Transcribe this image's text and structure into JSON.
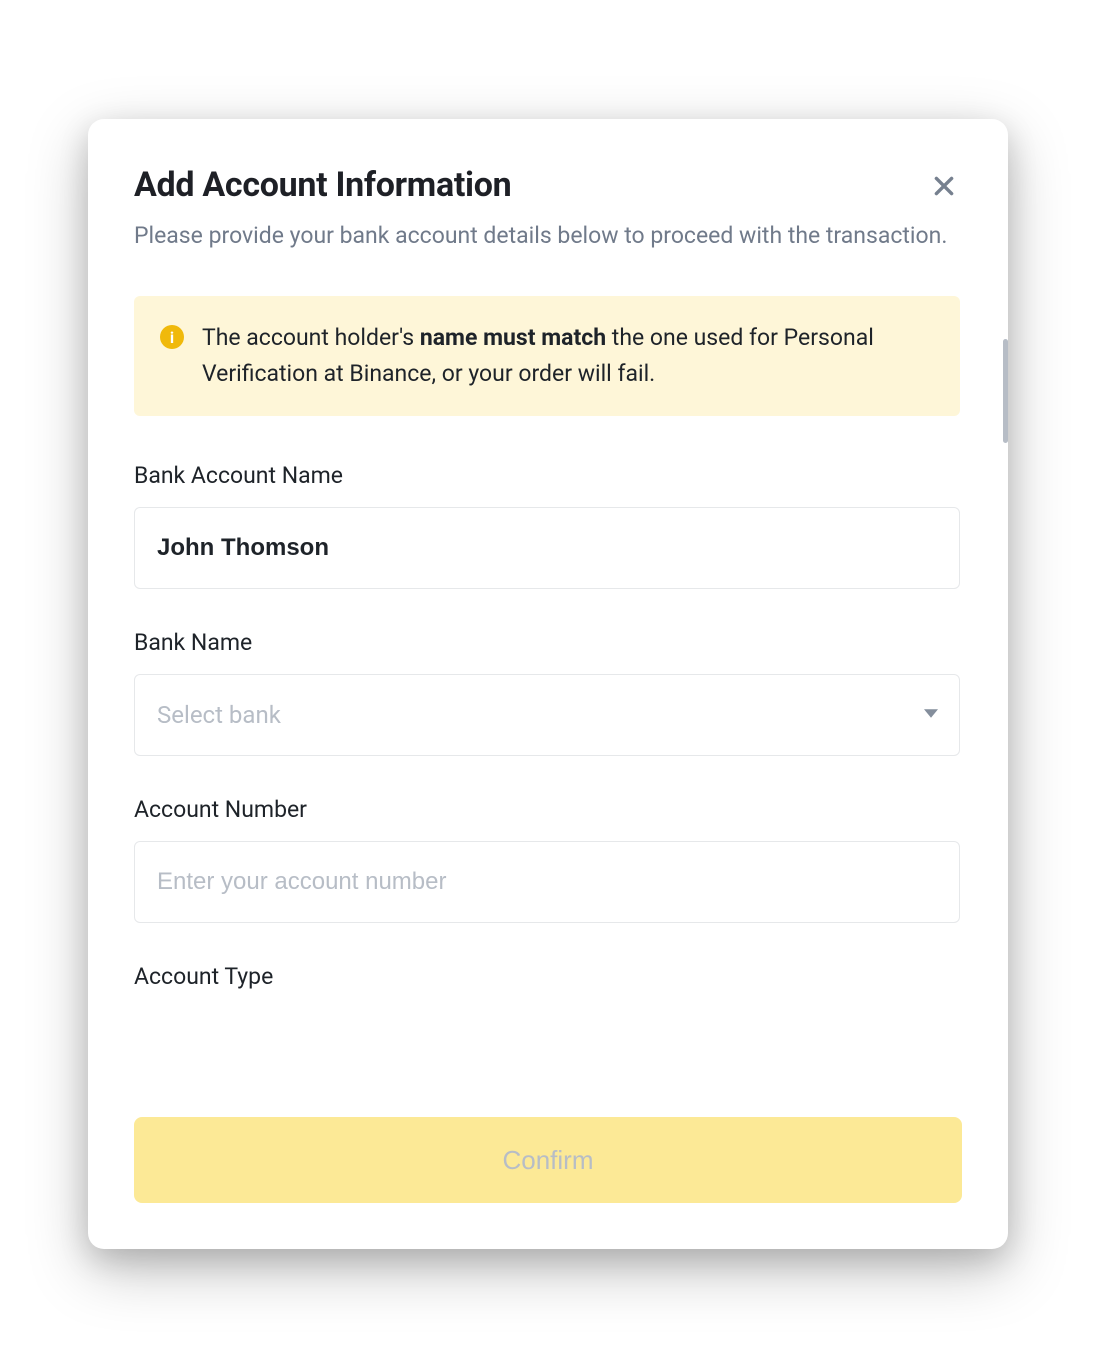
{
  "modal": {
    "title": "Add Account Information",
    "subtitle": "Please provide your bank account details below to proceed with the transaction."
  },
  "info_banner": {
    "prefix": "The account holder's ",
    "bold": "name must match",
    "suffix": " the one used for Personal Verification at Binance, or your order will fail."
  },
  "form": {
    "bank_account_name": {
      "label": "Bank Account Name",
      "value": "John Thomson"
    },
    "bank_name": {
      "label": "Bank Name",
      "placeholder": "Select bank"
    },
    "account_number": {
      "label": "Account Number",
      "placeholder": "Enter your account number"
    },
    "account_type": {
      "label": "Account Type"
    }
  },
  "actions": {
    "confirm": "Confirm"
  }
}
